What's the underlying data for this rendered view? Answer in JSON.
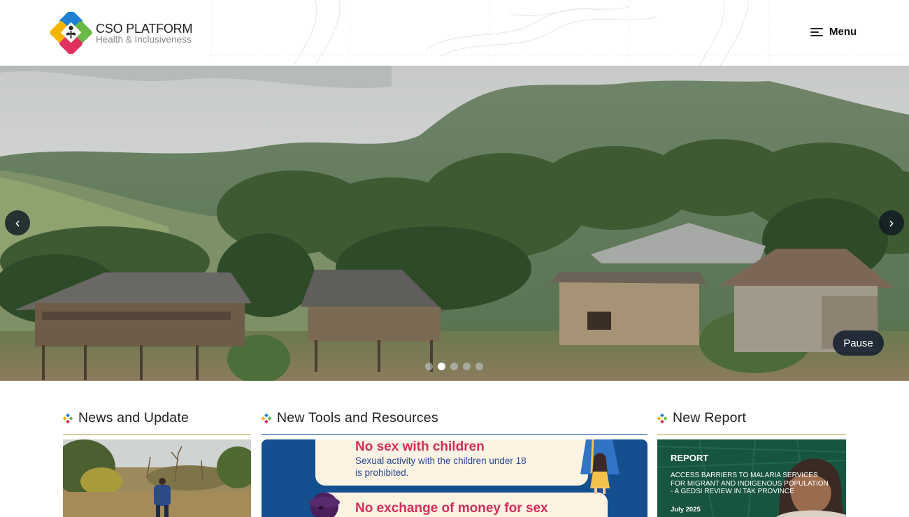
{
  "header": {
    "logo_title": "CSO PLATFORM",
    "logo_subtitle": "Health & Inclusiveness",
    "menu_label": "Menu"
  },
  "hero": {
    "prev_icon": "chevron-left-icon",
    "next_icon": "chevron-right-icon",
    "prev_glyph": "‹",
    "next_glyph": "›",
    "pause_label": "Pause",
    "slide_count": 5,
    "active_slide": 2
  },
  "sections": [
    {
      "title": "News and Update"
    },
    {
      "title": "New Tools and Resources"
    },
    {
      "title": "New Report"
    }
  ],
  "tools_card": {
    "item1_title": "No sex with children",
    "item1_text_line1": "Sexual activity with the children under 18",
    "item1_text_line2": "is prohibited.",
    "item2_title": "No exchange of money for sex"
  },
  "report_card": {
    "label": "REPORT",
    "description": "ACCESS BARRIERS TO MALARIA SERVICES FOR MIGRANT AND INDIGENOUS POPULATION - A GEDSI REVIEW IN TAK PROVINCE",
    "date": "July 2025"
  },
  "colors": {
    "accent_gold": "#c9a65a",
    "accent_blue": "#1e5aa8",
    "poster_blue": "#14508f",
    "poster_pink": "#d62d5a",
    "report_green": "#1f6f55",
    "logo_blue": "#1f7fd1",
    "logo_green": "#6ab845",
    "logo_yellow": "#f5b400",
    "logo_pink": "#e0315d"
  }
}
